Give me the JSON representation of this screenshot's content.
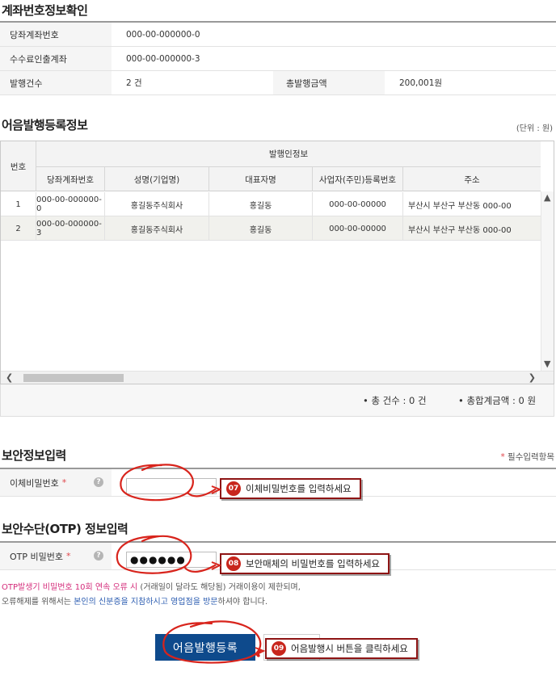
{
  "account_section": {
    "title": "계좌번호정보확인",
    "rows": [
      {
        "label": "당좌계좌번호",
        "value": "000-00-000000-0"
      },
      {
        "label": "수수료인출계좌",
        "value": "000-00-000000-3"
      }
    ],
    "count_label": "발행건수",
    "count_value": "2 건",
    "total_label": "총발행금액",
    "total_value": "200,001원"
  },
  "register_section": {
    "title": "어음발행등록정보",
    "unit": "(단위 : 원)",
    "group_header": "발행인정보",
    "columns": [
      "번호",
      "당좌계좌번호",
      "성명(기업명)",
      "대표자명",
      "사업자(주민)등록번호",
      "주소"
    ],
    "rows": [
      {
        "no": "1",
        "account": "000-00-000000-0",
        "name": "홍길동주식회사",
        "rep": "홍길동",
        "reg": "000-00-00000",
        "addr": "부산시 부산구 부산동 000-00"
      },
      {
        "no": "2",
        "account": "000-00-000000-3",
        "name": "홍길동주식회사",
        "rep": "홍길동",
        "reg": "000-00-00000",
        "addr": "부산시 부산구 부산동 000-00"
      }
    ],
    "summary_count": "• 총 건수 : 0 건",
    "summary_amount": "• 총합계금액 : 0 원"
  },
  "security_section": {
    "title": "보안정보입력",
    "required_note": "필수입력항목",
    "required_star": "*",
    "transfer_pw_label": "이체비밀번호",
    "transfer_pw_value": "",
    "callout_07_num": "07",
    "callout_07_text": "이체비밀번호를 입력하세요"
  },
  "otp_section": {
    "title": "보안수단(OTP) 정보입력",
    "otp_label": "OTP 비밀번호",
    "otp_value": "●●●●●●",
    "callout_08_num": "08",
    "callout_08_text": "보안매체의 비밀번호를 입력하세요",
    "warning_pink": "OTP발생기 비밀번호 10회 연속 오류 시",
    "warning_line1_rest": " (거래일이 달라도 해당됨) 거래이용이 제한되며,",
    "warning_line2_a": "오류해제를 위해서는 ",
    "warning_line2_blue": "본인의 신분증을 지참하시고 영업점을 방문",
    "warning_line2_b": "하셔야 합니다."
  },
  "actions": {
    "submit_label": "어음발행등록",
    "callout_09_num": "09",
    "callout_09_text": "어음발행시 버튼을 클릭하세요"
  },
  "help_glyph": "?",
  "colors": {
    "accent_red": "#c8261d",
    "primary_button": "#0e4a8c",
    "warning_pink": "#d42b7a",
    "link_blue": "#2a5bb0"
  }
}
